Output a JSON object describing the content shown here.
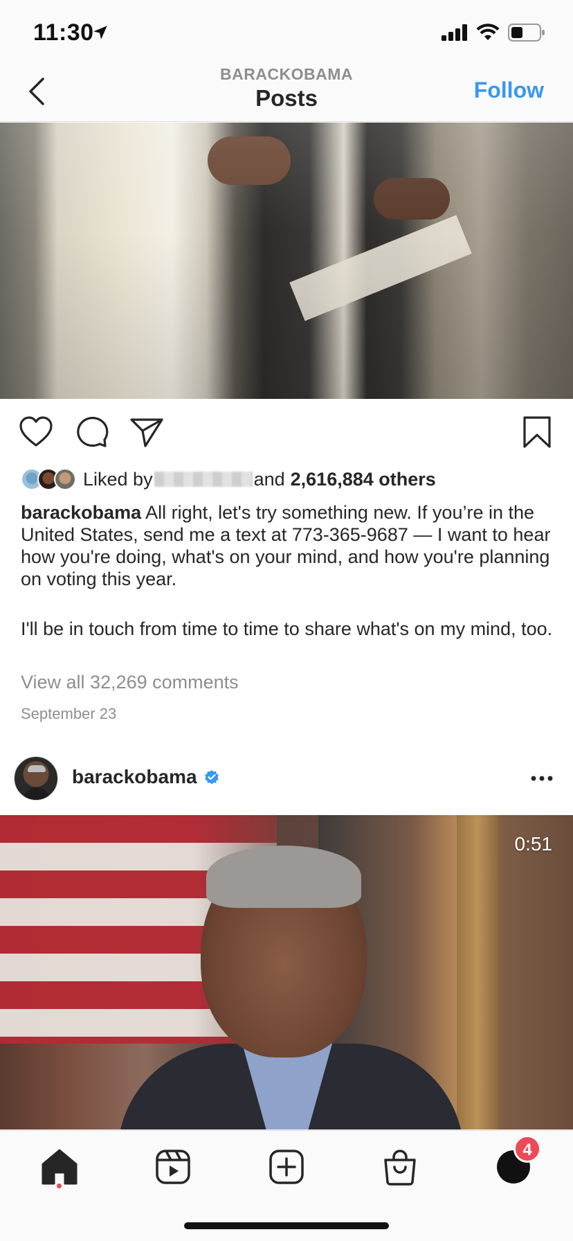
{
  "status_bar": {
    "time": "11:30",
    "icons": [
      "location-arrow-icon",
      "cellular-signal-icon",
      "wifi-icon",
      "battery-icon"
    ]
  },
  "header": {
    "subtitle": "BARACKOBAMA",
    "title": "Posts",
    "follow_label": "Follow",
    "back_icon": "chevron-left-icon"
  },
  "post1": {
    "action_icons": [
      "heart-icon",
      "comment-icon",
      "share-icon",
      "bookmark-icon"
    ],
    "liked_by_prefix": "Liked by",
    "liked_by_and": "and",
    "likes_count_text": "2,616,884 others",
    "caption_username": "barackobama",
    "caption_text": "All right, let's try something new. If you’re in the United States, send me a text at 773-365-9687 — I want to hear how you're doing, what's on your mind, and how you're planning on voting this year.",
    "caption_text_2": "I'll be in touch from time to time to share what's on my mind, too.",
    "view_comments": "View all 32,269 comments",
    "date": "September 23"
  },
  "post2": {
    "username": "barackobama",
    "verified": true,
    "video_duration": "0:51"
  },
  "tab_bar": {
    "tabs": [
      "home-icon",
      "reels-icon",
      "new-post-icon",
      "shop-icon",
      "profile-icon"
    ],
    "notification_count": "4"
  },
  "colors": {
    "accent_blue": "#3897f0",
    "badge_red": "#ed4956",
    "text_primary": "#262626",
    "text_secondary": "#8e8e8e"
  }
}
